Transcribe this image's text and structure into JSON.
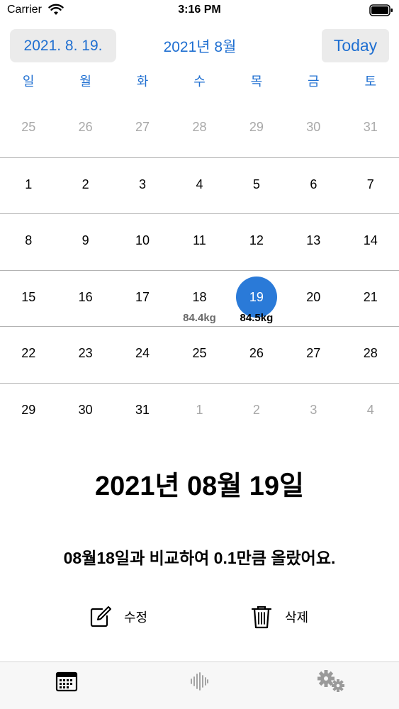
{
  "status_bar": {
    "carrier": "Carrier",
    "time": "3:16 PM"
  },
  "header": {
    "selected_date": "2021. 8. 19.",
    "month_title": "2021년 8월",
    "today_label": "Today"
  },
  "weekdays": [
    "일",
    "월",
    "화",
    "수",
    "목",
    "금",
    "토"
  ],
  "weeks": [
    [
      {
        "d": "25",
        "m": true
      },
      {
        "d": "26",
        "m": true
      },
      {
        "d": "27",
        "m": true
      },
      {
        "d": "28",
        "m": true
      },
      {
        "d": "29",
        "m": true
      },
      {
        "d": "30",
        "m": true
      },
      {
        "d": "31",
        "m": true
      }
    ],
    [
      {
        "d": "1"
      },
      {
        "d": "2"
      },
      {
        "d": "3"
      },
      {
        "d": "4"
      },
      {
        "d": "5"
      },
      {
        "d": "6"
      },
      {
        "d": "7"
      }
    ],
    [
      {
        "d": "8"
      },
      {
        "d": "9"
      },
      {
        "d": "10"
      },
      {
        "d": "11"
      },
      {
        "d": "12"
      },
      {
        "d": "13"
      },
      {
        "d": "14"
      }
    ],
    [
      {
        "d": "15"
      },
      {
        "d": "16"
      },
      {
        "d": "17"
      },
      {
        "d": "18",
        "w": "84.4kg"
      },
      {
        "d": "19",
        "w": "84.5kg",
        "sel": true
      },
      {
        "d": "20"
      },
      {
        "d": "21"
      }
    ],
    [
      {
        "d": "22"
      },
      {
        "d": "23"
      },
      {
        "d": "24"
      },
      {
        "d": "25"
      },
      {
        "d": "26"
      },
      {
        "d": "27"
      },
      {
        "d": "28"
      }
    ],
    [
      {
        "d": "29"
      },
      {
        "d": "30"
      },
      {
        "d": "31"
      },
      {
        "d": "1",
        "m": true
      },
      {
        "d": "2",
        "m": true
      },
      {
        "d": "3",
        "m": true
      },
      {
        "d": "4",
        "m": true
      }
    ]
  ],
  "detail": {
    "date_text": "2021년 08월 19일",
    "message": "08월18일과 비교하여 0.1만큼 올랐어요."
  },
  "actions": {
    "edit_label": "수정",
    "delete_label": "삭제"
  },
  "tabs": [
    {
      "icon": "calendar-icon"
    },
    {
      "icon": "waveform-icon"
    },
    {
      "icon": "gears-icon"
    }
  ],
  "colors": {
    "accent": "#1f6fd1",
    "selected_circle": "#2a7ad8",
    "muted": "#a8a8a8"
  }
}
